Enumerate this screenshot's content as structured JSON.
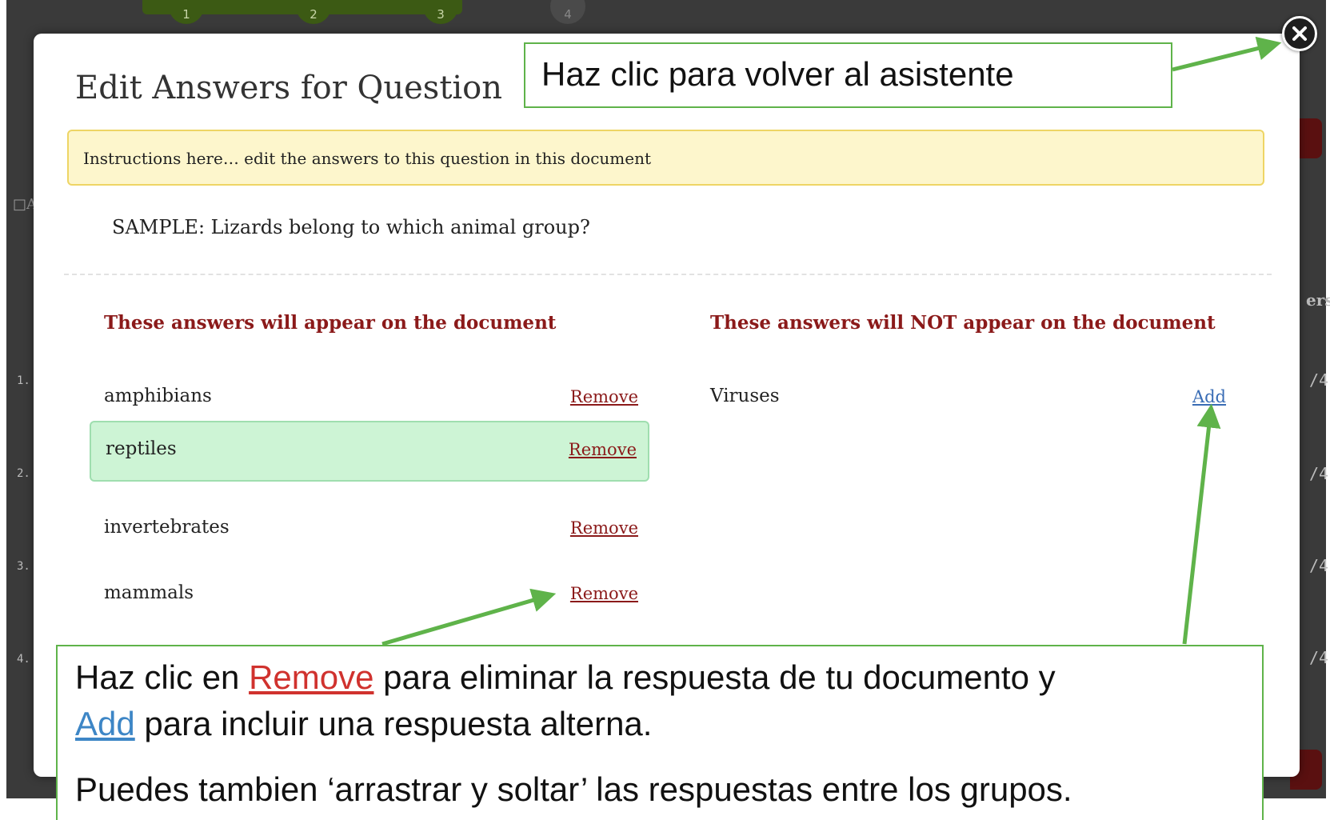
{
  "background": {
    "steps": [
      "1",
      "2",
      "3",
      "4"
    ],
    "row_numbers": [
      "1.",
      "2.",
      "3.",
      "4."
    ],
    "fractions": [
      "/4",
      "/4",
      "/4",
      "/4"
    ],
    "header_fragment": "ers",
    "checkbox_fragment": "□A"
  },
  "modal": {
    "title": "Edit Answers for Question",
    "instructions": "Instructions here… edit the answers to this question in this document",
    "question": "SAMPLE: Lizards belong to which animal group?",
    "included": {
      "heading": "These answers will appear on the document",
      "link_label": "Remove",
      "items": [
        "amphibians",
        "reptiles",
        "invertebrates",
        "mammals"
      ]
    },
    "excluded": {
      "heading": "These answers will NOT appear on the document",
      "link_label": "Add",
      "items": [
        "Viruses"
      ]
    }
  },
  "callouts": {
    "top": "Haz clic para volver al asistente",
    "bottom": {
      "line1_prefix": "Haz clic en ",
      "line1_remove": "Remove",
      "line1_suffix": " para eliminar la respuesta de tu documento y",
      "line2_add": "Add",
      "line2_suffix": " para incluir una respuesta alterna.",
      "line3": "Puedes tambien ‘arrastrar y soltar’ las respuestas entre los grupos."
    }
  },
  "colors": {
    "accent_green": "#5fb34a",
    "remove_red": "#8b1a1a",
    "add_blue": "#3a6db5",
    "highlight_row": "#cdf4d5",
    "instructions_bg": "#fdf6cc"
  },
  "icons": {
    "close": "close-icon"
  }
}
